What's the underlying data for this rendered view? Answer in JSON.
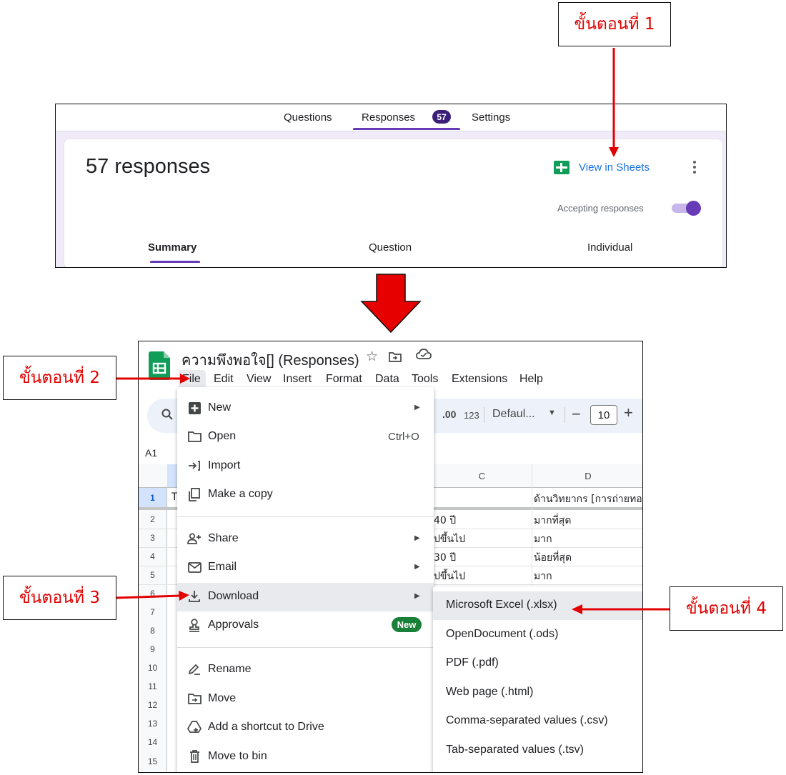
{
  "steps": {
    "step1": "ขั้นตอนที่ 1",
    "step2": "ขั้นตอนที่ 2",
    "step3": "ขั้นตอนที่ 3",
    "step4": "ขั้นตอนที่ 4"
  },
  "colors": {
    "arrow": "#e30000",
    "forms_accent": "#673ab7",
    "sheets_green": "#0f9d58"
  },
  "forms": {
    "tabs": [
      "Questions",
      "Responses",
      "Settings"
    ],
    "responses_badge": "57",
    "heading": "57 responses",
    "view_in_sheets": "View in Sheets",
    "accepting_label": "Accepting responses",
    "accepting_enabled": true,
    "subtabs": [
      "Summary",
      "Question",
      "Individual"
    ]
  },
  "sheets": {
    "title": "ความพึงพอใจ[] (Responses)",
    "menubar": [
      "File",
      "Edit",
      "View",
      "Insert",
      "Format",
      "Data",
      "Tools",
      "Extensions",
      "Help"
    ],
    "toolbar": {
      "decimal": ".00",
      "number_format": "123",
      "font": "Defaul...",
      "font_size": "10"
    },
    "name_box": "A1",
    "columns": [
      "C",
      "D"
    ],
    "rows": [
      "1",
      "2",
      "3",
      "4",
      "5",
      "6",
      "7",
      "8",
      "9",
      "10",
      "11",
      "12",
      "13",
      "14",
      "15"
    ],
    "row1_a": "T",
    "column_c": [
      "",
      "40 ปี",
      "ปขึ้นไป",
      "30 ปี",
      "ปขึ้นไป"
    ],
    "column_d": [
      "ด้านวิทยากร [การถ่ายทอด",
      "มากที่สุด",
      "มาก",
      "น้อยที่สุด",
      "มาก"
    ]
  },
  "file_menu": {
    "items": [
      {
        "label": "New",
        "icon": "plus-square-icon",
        "submenu": true
      },
      {
        "label": "Open",
        "icon": "folder-icon",
        "shortcut": "Ctrl+O"
      },
      {
        "label": "Import",
        "icon": "import-icon"
      },
      {
        "label": "Make a copy",
        "icon": "copy-icon"
      },
      {
        "label": "Share",
        "icon": "share-person-icon",
        "submenu": true
      },
      {
        "label": "Email",
        "icon": "email-icon",
        "submenu": true
      },
      {
        "label": "Download",
        "icon": "download-icon",
        "submenu": true
      },
      {
        "label": "Approvals",
        "icon": "approvals-icon",
        "badge": "New"
      },
      {
        "label": "Rename",
        "icon": "rename-icon"
      },
      {
        "label": "Move",
        "icon": "move-icon"
      },
      {
        "label": "Add a shortcut to Drive",
        "icon": "drive-shortcut-icon"
      },
      {
        "label": "Move to bin",
        "icon": "trash-icon"
      }
    ]
  },
  "download_submenu": {
    "items": [
      "Microsoft Excel (.xlsx)",
      "OpenDocument (.ods)",
      "PDF (.pdf)",
      "Web page (.html)",
      "Comma-separated values (.csv)",
      "Tab-separated values (.tsv)"
    ]
  }
}
